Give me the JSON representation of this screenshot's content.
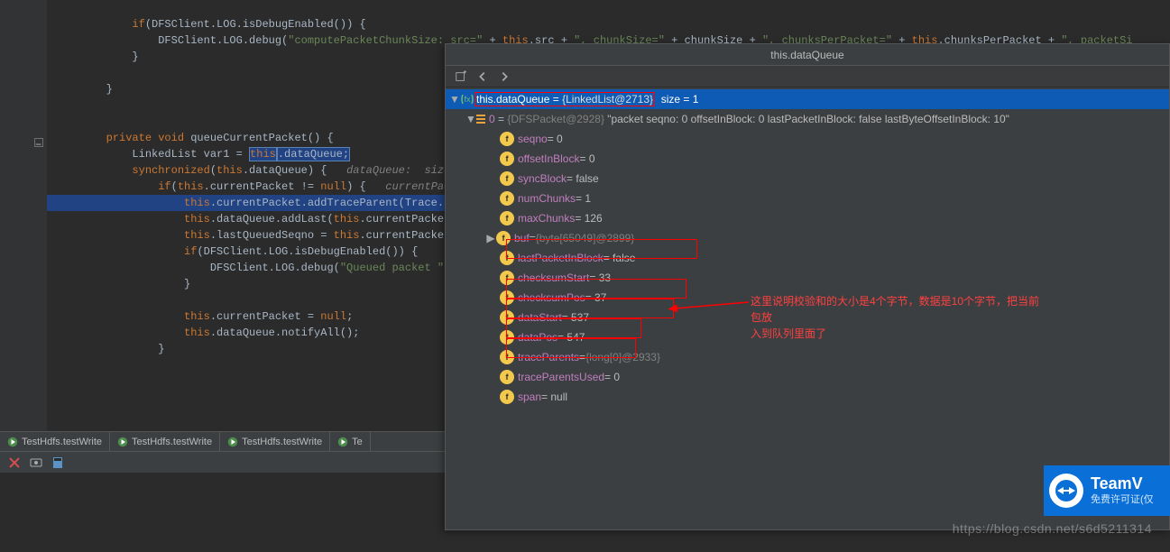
{
  "code": {
    "l1a": "            if",
    "l1b": "(DFSClient.LOG.isDebugEnabled()) {",
    "l2a": "                DFSClient.LOG.debug(",
    "l2b": "\"computePacketChunkSize: src=\"",
    "l2c": " + ",
    "l2d": "this",
    "l2e": ".src + ",
    "l2f": "\", chunkSize=\"",
    "l2g": " + chunkSize + ",
    "l2h": "\", chunksPerPacket=\"",
    "l2i": " + ",
    "l2j": "this",
    "l2k": ".chunksPerPacket + ",
    "l2l": "\", packetSi",
    "l3": "            }",
    "l4": "        }",
    "l5a": "        private void ",
    "l5b": "queueCurrentPacket() {",
    "l6a": "            LinkedList var1 = ",
    "l6b": "this",
    "l6c": ".dataQueue;",
    "l7a": "            synchronized",
    "l7b": "(",
    "l7c": "this",
    "l7d": ".dataQueue) {   ",
    "l7e": "dataQueue:  size",
    "l8a": "                if",
    "l8b": "(",
    "l8c": "this",
    "l8d": ".currentPacket != ",
    "l8e": "null",
    "l8f": ") {   ",
    "l8g": "currentPac",
    "l9a": "                    this",
    "l9b": ".currentPacket.addTraceParent(Trace.",
    "l10a": "                    this",
    "l10b": ".dataQueue.addLast(",
    "l10c": "this",
    "l10d": ".currentPacke",
    "l11a": "                    this",
    "l11b": ".lastQueuedSeqno = ",
    "l11c": "this",
    "l11d": ".currentPacke",
    "l12a": "                    if",
    "l12b": "(DFSClient.LOG.isDebugEnabled()) {",
    "l13a": "                        DFSClient.LOG.debug(",
    "l13b": "\"Queued packet \"",
    "l14": "                    }",
    "l15a": "                    this",
    "l15b": ".currentPacket = ",
    "l15c": "null",
    "l15d": ";",
    "l16a": "                    this",
    "l16b": ".dataQueue.notifyAll();",
    "l17": "                }"
  },
  "tabs": [
    "TestHdfs.testWrite",
    "TestHdfs.testWrite",
    "TestHdfs.testWrite",
    "Te"
  ],
  "debug": {
    "title": "this.dataQueue",
    "root": {
      "name": "this.dataQueue",
      "cls": "{LinkedList@2713}",
      "size": "size = 1"
    },
    "elem0": {
      "idx": "0",
      "cls": "{DFSPacket@2928}",
      "str": "\"packet seqno: 0 offsetInBlock: 0 lastPacketInBlock: false lastByteOffsetInBlock: 10\""
    },
    "fields": [
      {
        "n": "seqno",
        "v": "= 0"
      },
      {
        "n": "offsetInBlock",
        "v": "= 0"
      },
      {
        "n": "syncBlock",
        "v": "= false"
      },
      {
        "n": "numChunks",
        "v": "= 1"
      },
      {
        "n": "maxChunks",
        "v": "= 126"
      },
      {
        "n": "buf",
        "v": "= ",
        "g": "{byte[65049]@2899}",
        "exp": true
      },
      {
        "n": "lastPacketInBlock",
        "v": "= false"
      },
      {
        "n": "checksumStart",
        "v": "= 33",
        "box": true
      },
      {
        "n": "checksumPos",
        "v": "= 37",
        "box": true
      },
      {
        "n": "dataStart",
        "v": "= 537",
        "box": true
      },
      {
        "n": "dataPos",
        "v": "= 547",
        "box": true
      },
      {
        "n": "traceParents",
        "v": "= ",
        "g": "{long[0]@2933}"
      },
      {
        "n": "traceParentsUsed",
        "v": "= 0"
      },
      {
        "n": "span",
        "v": "= null"
      }
    ]
  },
  "annotation": {
    "l1": "这里说明校验和的大小是4个字节，数据是10个字节，把当前包放",
    "l2": "入到队列里面了"
  },
  "watermark": "https://blog.csdn.net/s6d5211314",
  "tv": {
    "brand": "TeamV",
    "sub": "免费许可证(仅"
  }
}
